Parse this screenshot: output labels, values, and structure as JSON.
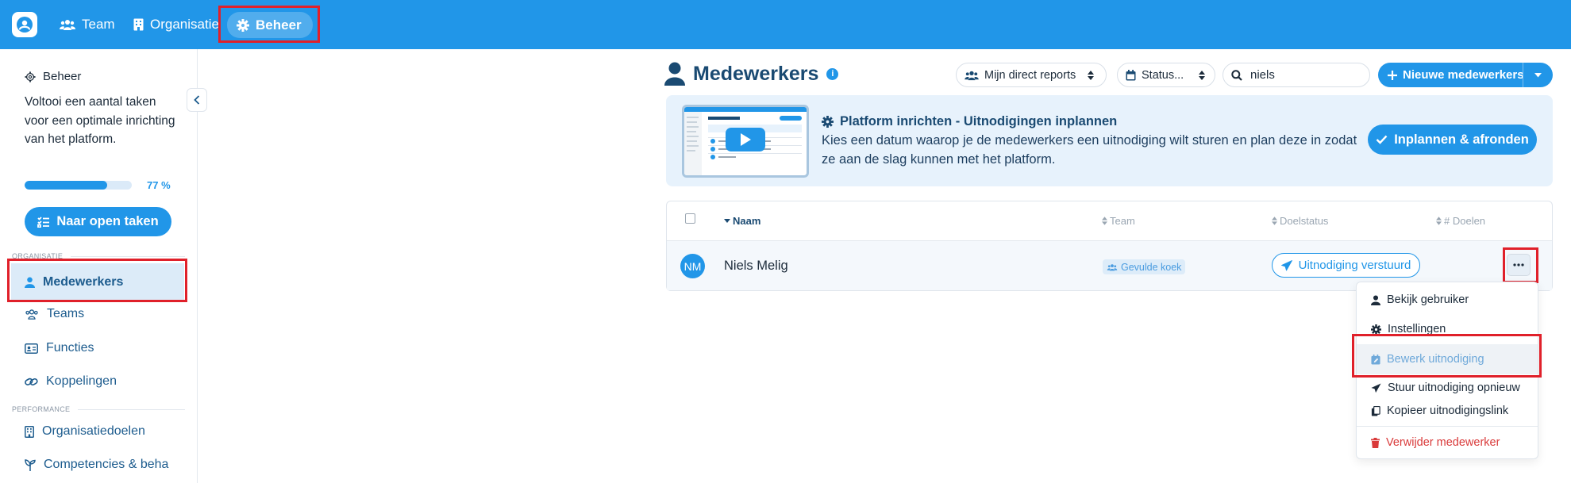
{
  "topnav": {
    "items": [
      {
        "label": "Team",
        "icon": "users-icon"
      },
      {
        "label": "Organisatie",
        "icon": "building-icon"
      },
      {
        "label": "Beheer",
        "icon": "gear-icon",
        "active": true
      }
    ]
  },
  "sidebar": {
    "heading": "Beheer",
    "description": "Voltooi een aantal taken voor een optimale inrichting van het platform.",
    "progress": {
      "value": 77,
      "label": "77 %"
    },
    "open_tasks_button": "Naar open taken",
    "sections": [
      {
        "label": "ORGANISATIE",
        "items": [
          {
            "label": "Medewerkers",
            "icon": "user-icon",
            "active": true
          },
          {
            "label": "Teams",
            "icon": "users-icon"
          },
          {
            "label": "Functies",
            "icon": "id-card-icon"
          },
          {
            "label": "Koppelingen",
            "icon": "link-icon"
          }
        ]
      },
      {
        "label": "PERFORMANCE",
        "items": [
          {
            "label": "Organisatiedoelen",
            "icon": "building-icon"
          },
          {
            "label": "Competencies & beha",
            "icon": "seedling-icon"
          }
        ]
      }
    ]
  },
  "header": {
    "title": "Medewerkers",
    "filter_reports": "Mijn direct reports",
    "filter_status": "Status...",
    "search_value": "niels",
    "new_button": "Nieuwe medewerkers"
  },
  "banner": {
    "title": "Platform inrichten - Uitnodigingen inplannen",
    "text": "Kies een datum waarop je de medewerkers een uitnodiging wilt sturen en plan deze in zodat ze aan de slag kunnen met het platform.",
    "button": "Inplannen & afronden"
  },
  "table": {
    "columns": [
      "Naam",
      "Team",
      "Doelstatus",
      "# Doelen"
    ],
    "rows": [
      {
        "initials": "NM",
        "name": "Niels Melig",
        "team": "Gevulde koek",
        "status": "Uitnodiging verstuurd"
      }
    ]
  },
  "row_menu": {
    "items": [
      {
        "label": "Bekijk gebruiker",
        "icon": "user-icon"
      },
      {
        "label": "Instellingen",
        "icon": "gear-icon"
      },
      {
        "label": "Bewerk uitnodiging",
        "icon": "calendar-edit-icon"
      },
      {
        "label": "Stuur uitnodiging opnieuw",
        "icon": "paper-plane-icon"
      },
      {
        "label": "Kopieer uitnodigingslink",
        "icon": "copy-icon"
      },
      {
        "label": "Verwijder medewerker",
        "icon": "trash-icon"
      }
    ]
  },
  "colors": {
    "primary": "#2196e8",
    "highlight": "#e0202a",
    "danger": "#d93a3a",
    "title": "#1a4a72"
  }
}
